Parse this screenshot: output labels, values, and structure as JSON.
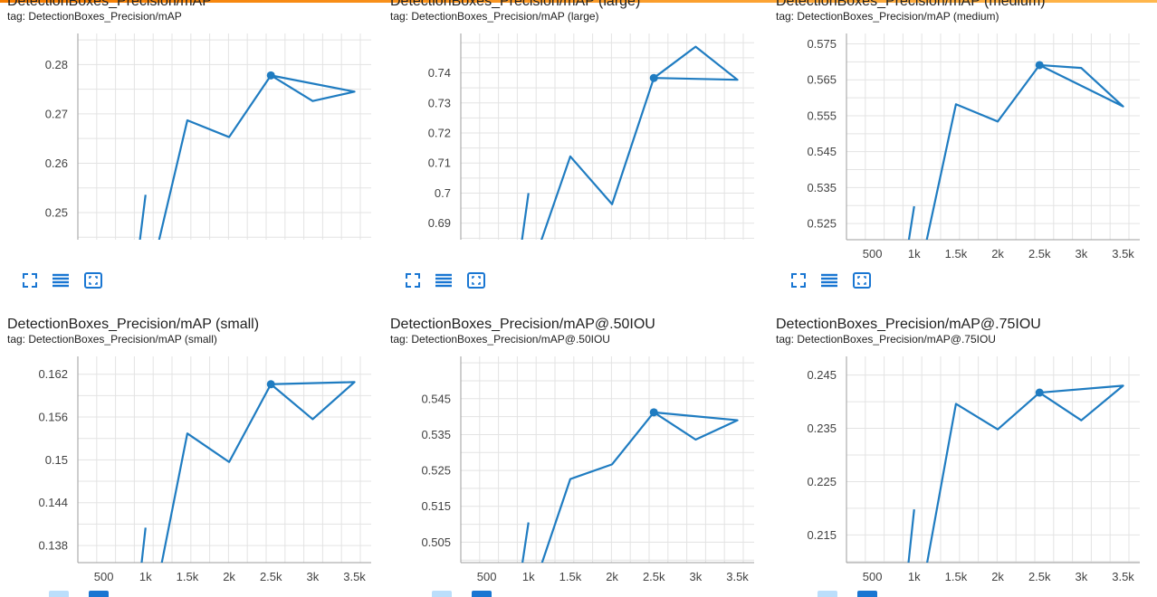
{
  "colors": {
    "line": "#1f7cc1",
    "grid": "#e3e3e3",
    "axis": "#9e9e9e",
    "text": "#424242",
    "accent": "#f57c00",
    "icon": "#1976d2"
  },
  "icons": {
    "fit": "fit-domain-icon",
    "legend": "toggle-log-icon",
    "expand": "expand-icon"
  },
  "chart_data": [
    {
      "type": "line",
      "title": "DetectionBoxes_Precision/mAP",
      "tag": "tag: DetectionBoxes_Precision/mAP",
      "y_ticks": [
        "0.28",
        "0.27",
        "0.26",
        "0.25"
      ],
      "y_tick_values": [
        0.28,
        0.27,
        0.26,
        0.25
      ],
      "ylim": [
        0.2445,
        0.2863
      ],
      "x_ticks": [],
      "xlim": [
        190,
        3700
      ],
      "x": [
        900,
        1000,
        1100,
        1500,
        2000,
        2500,
        3000,
        3500,
        2500
      ],
      "y": [
        0.24,
        0.2536,
        0.24,
        0.2687,
        0.2653,
        0.2778,
        0.2726,
        0.2745,
        0.2778
      ],
      "highlight": {
        "x": 2500,
        "y": 0.2778
      },
      "show_x_axis": false
    },
    {
      "type": "line",
      "title": "DetectionBoxes_Precision/mAP (large)",
      "tag": "tag: DetectionBoxes_Precision/mAP (large)",
      "y_ticks": [
        "0.74",
        "0.73",
        "0.72",
        "0.71",
        "0.7",
        "0.69"
      ],
      "y_tick_values": [
        0.74,
        0.73,
        0.72,
        0.71,
        0.7,
        0.69
      ],
      "ylim": [
        0.6845,
        0.7531
      ],
      "x_ticks": [],
      "xlim": [
        190,
        3700
      ],
      "x": [
        900,
        1000,
        1100,
        1500,
        2000,
        2500,
        3000,
        3500,
        2500
      ],
      "y": [
        0.68,
        0.7,
        0.68,
        0.7122,
        0.6963,
        0.7383,
        0.7487,
        0.7377,
        0.7383
      ],
      "highlight": {
        "x": 2500,
        "y": 0.7383
      },
      "show_x_axis": false
    },
    {
      "type": "line",
      "title": "DetectionBoxes_Precision/mAP (medium)",
      "tag": "tag: DetectionBoxes_Precision/mAP (medium)",
      "y_ticks": [
        "0.575",
        "0.565",
        "0.555",
        "0.545",
        "0.535",
        "0.525"
      ],
      "y_tick_values": [
        0.575,
        0.565,
        0.555,
        0.545,
        0.535,
        0.525
      ],
      "ylim": [
        0.5205,
        0.5779
      ],
      "x_ticks": [
        "500",
        "1k",
        "1.5k",
        "2k",
        "2.5k",
        "3k",
        "3.5k"
      ],
      "x_tick_values": [
        500,
        1000,
        1500,
        2000,
        2500,
        3000,
        3500
      ],
      "xlim": [
        190,
        3700
      ],
      "x": [
        900,
        1000,
        1100,
        1500,
        2000,
        2500,
        3000,
        3500,
        2500
      ],
      "y": [
        0.515,
        0.5298,
        0.515,
        0.5582,
        0.5534,
        0.5691,
        0.5683,
        0.5576,
        0.5691
      ],
      "highlight": {
        "x": 2500,
        "y": 0.5691
      },
      "show_x_axis": true
    },
    {
      "type": "line",
      "title": "DetectionBoxes_Precision/mAP (small)",
      "tag": "tag: DetectionBoxes_Precision/mAP (small)",
      "y_ticks": [
        "0.162",
        "0.156",
        "0.15",
        "0.144",
        "0.138"
      ],
      "y_tick_values": [
        0.162,
        0.156,
        0.15,
        0.144,
        0.138
      ],
      "ylim": [
        0.1356,
        0.1645
      ],
      "x_ticks": [
        "500",
        "1k",
        "1.5k",
        "2k",
        "2.5k",
        "3k",
        "3.5k"
      ],
      "x_tick_values": [
        500,
        1000,
        1500,
        2000,
        2500,
        3000,
        3500
      ],
      "xlim": [
        190,
        3700
      ],
      "x": [
        900,
        1000,
        1100,
        1500,
        2000,
        2500,
        3000,
        3500,
        2500
      ],
      "y": [
        0.13,
        0.1405,
        0.13,
        0.1537,
        0.1497,
        0.1606,
        0.1557,
        0.1609,
        0.1606
      ],
      "highlight": {
        "x": 2500,
        "y": 0.1606
      },
      "show_x_axis": true
    },
    {
      "type": "line",
      "title": "DetectionBoxes_Precision/mAP@.50IOU",
      "tag": "tag: DetectionBoxes_Precision/mAP@.50IOU",
      "y_ticks": [
        "0.545",
        "0.535",
        "0.525",
        "0.515",
        "0.505"
      ],
      "y_tick_values": [
        0.545,
        0.535,
        0.525,
        0.515,
        0.505
      ],
      "ylim": [
        0.4993,
        0.5568
      ],
      "x_ticks": [
        "500",
        "1k",
        "1.5k",
        "2k",
        "2.5k",
        "3k",
        "3.5k"
      ],
      "x_tick_values": [
        500,
        1000,
        1500,
        2000,
        2500,
        3000,
        3500
      ],
      "xlim": [
        190,
        3700
      ],
      "x": [
        900,
        1000,
        1100,
        1500,
        2000,
        2500,
        3000,
        3500,
        2500
      ],
      "y": [
        0.495,
        0.5105,
        0.495,
        0.5226,
        0.5267,
        0.5412,
        0.5336,
        0.539,
        0.5412
      ],
      "highlight": {
        "x": 2500,
        "y": 0.5412
      },
      "show_x_axis": true
    },
    {
      "type": "line",
      "title": "DetectionBoxes_Precision/mAP@.75IOU",
      "tag": "tag: DetectionBoxes_Precision/mAP@.75IOU",
      "y_ticks": [
        "0.245",
        "0.235",
        "0.225",
        "0.215"
      ],
      "y_tick_values": [
        0.245,
        0.235,
        0.225,
        0.215
      ],
      "ylim": [
        0.2098,
        0.2485
      ],
      "x_ticks": [
        "500",
        "1k",
        "1.5k",
        "2k",
        "2.5k",
        "3k",
        "3.5k"
      ],
      "x_tick_values": [
        500,
        1000,
        1500,
        2000,
        2500,
        3000,
        3500
      ],
      "xlim": [
        190,
        3700
      ],
      "x": [
        900,
        1000,
        1100,
        1500,
        2000,
        2500,
        3000,
        3500,
        2500
      ],
      "y": [
        0.205,
        0.2198,
        0.205,
        0.2396,
        0.2348,
        0.2417,
        0.2365,
        0.243,
        0.2417
      ],
      "highlight": {
        "x": 2500,
        "y": 0.2417
      },
      "show_x_axis": true
    }
  ]
}
